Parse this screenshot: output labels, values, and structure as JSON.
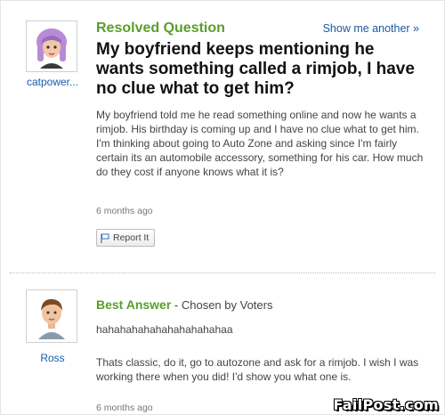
{
  "question": {
    "status_label": "Resolved Question",
    "show_another_label": "Show me another »",
    "username": "catpower...",
    "title": "My boyfriend keeps mentioning he wants something called a rimjob, I have no clue what to get him?",
    "body": "My boyfriend told me he read something online and now he wants a rimjob. His birthday is coming up and I have no clue what to get him. I'm thinking about going to Auto Zone and asking since I'm fairly certain its an automobile accessory, something for his car. How much do they cost if anyone knows what it is?",
    "timestamp": "6 months ago",
    "report_label": "Report It",
    "avatar_icon": "female-avatar-purple-hair",
    "report_icon": "flag-icon"
  },
  "answer": {
    "label": "Best Answer",
    "chosen_by": " - Chosen by Voters",
    "username": "Ross",
    "laugh_line": "hahahahahahahahahahahaa",
    "body": "Thats classic, do it, go to autozone and ask for a rimjob. I wish I was working there when you did! I'd show you what one is.",
    "timestamp": "6 months ago",
    "avatar_icon": "male-avatar-brown-hair"
  },
  "watermark": "FailPost.com",
  "colors": {
    "status_green": "#5a9e2a",
    "link_blue": "#1a5aa8",
    "title_text": "#111111"
  }
}
